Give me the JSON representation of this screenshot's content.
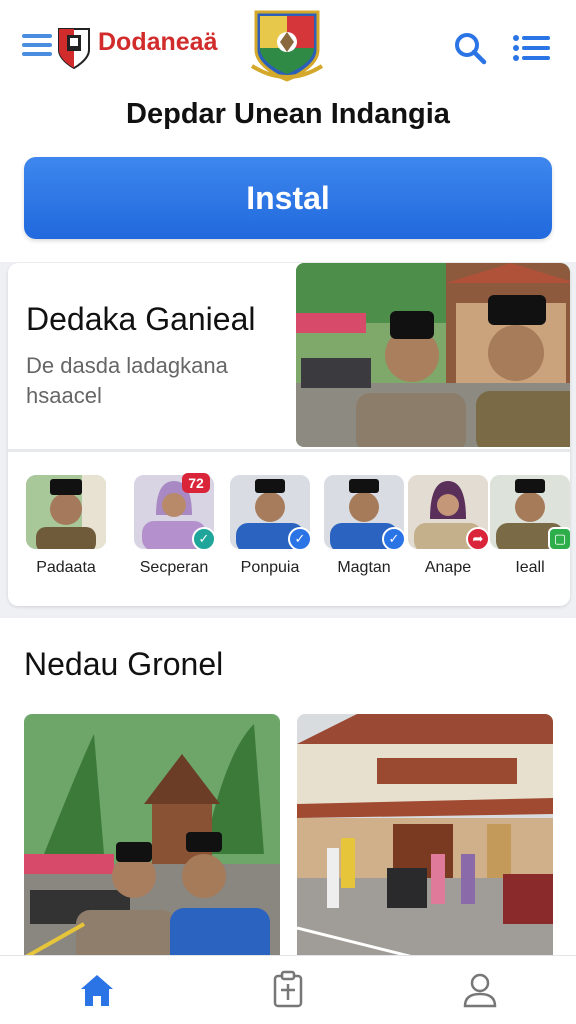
{
  "header": {
    "brand_name": "Dodaneaä",
    "page_title": "Depdar Unean Indangia",
    "icons": [
      "hamburger-menu-icon",
      "shield-logo",
      "crest-emblem",
      "search-icon",
      "list-icon"
    ]
  },
  "install": {
    "label": "Instal"
  },
  "featured": {
    "title": "Dedaka Ganieal",
    "description": "De dasda ladagkana hsaacel"
  },
  "people": [
    {
      "name": "Padaata",
      "badge": "none"
    },
    {
      "name": "Secperan",
      "badge": "check",
      "count": "72"
    },
    {
      "name": "Ponpuia",
      "badge": "check"
    },
    {
      "name": "Magtan",
      "badge": "check"
    },
    {
      "name": "Anape",
      "badge": "share"
    },
    {
      "name": "Ieall",
      "badge": "app"
    }
  ],
  "section": {
    "title": "Nedau Gronel"
  },
  "bottom_nav": {
    "items": [
      "home-icon",
      "document-icon",
      "profile-icon"
    ]
  },
  "colors": {
    "accent": "#2a74e6",
    "brand_red": "#d12b2b",
    "badge_teal": "#1fa59a",
    "badge_red": "#d9243a",
    "badge_green": "#2eae4a"
  }
}
